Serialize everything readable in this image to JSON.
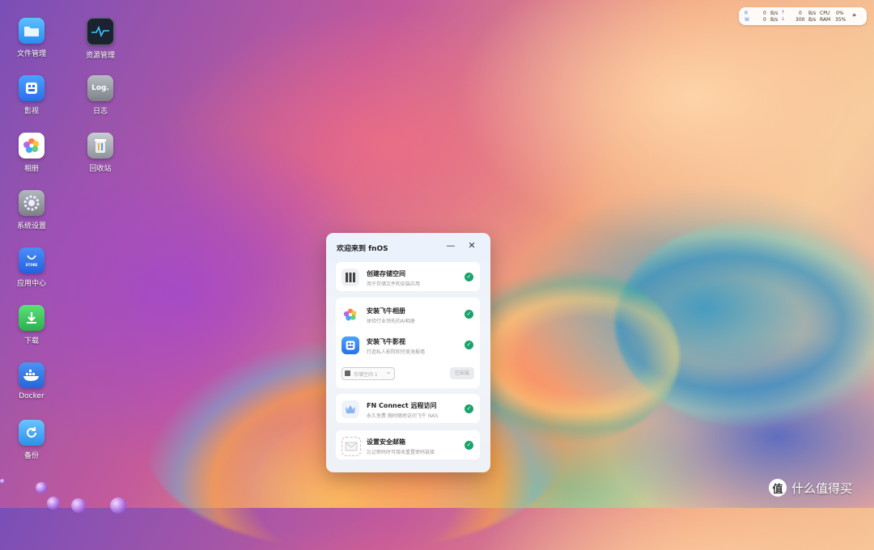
{
  "desktop": {
    "icons": [
      {
        "label": "文件管理",
        "icon": "folder-icon",
        "color": "#2f9bf5"
      },
      {
        "label": "资源管理",
        "icon": "monitor-icon",
        "color": "#1b2230"
      },
      {
        "label": "影视",
        "icon": "film-icon",
        "color": "#2d7ff0"
      },
      {
        "label": "日志",
        "icon": "log-icon",
        "color": "#8b8f95"
      },
      {
        "label": "相册",
        "icon": "photos-icon",
        "color": "#ffffff"
      },
      {
        "label": "回收站",
        "icon": "trash-icon",
        "color": "#9aa0a8"
      },
      {
        "label": "系统设置",
        "icon": "gear-icon",
        "color": "#8a8f96"
      },
      {
        "label": "应用中心",
        "icon": "store-icon",
        "color": "#2f74ee"
      },
      {
        "label": "下载",
        "icon": "download-icon",
        "color": "#35c25a"
      },
      {
        "label": "Docker",
        "icon": "docker-icon",
        "color": "#2a73e0"
      },
      {
        "label": "备份",
        "icon": "backup-icon",
        "color": "#3aa0ef"
      }
    ],
    "log_badge": "Log.",
    "store_badge": "STORE"
  },
  "status": {
    "r_label": "R",
    "w_label": "W",
    "r_value": "0",
    "w_value": "0",
    "r_unit": "B/s",
    "w_unit": "B/s",
    "up_value": "0",
    "down_value": "300",
    "up_unit": "B/s",
    "down_unit": "B/s",
    "cpu_label": "CPU",
    "ram_label": "RAM",
    "cpu_value": "0%",
    "ram_value": "35%"
  },
  "window": {
    "title": "欢迎来到 fnOS",
    "items": [
      {
        "title": "创建存储空间",
        "desc": "用于存储文件和安装应用",
        "icon": "storage-icon",
        "done": true
      },
      {
        "title": "安装飞牛相册",
        "desc": "体验行业领先的AI相册",
        "icon": "photos-icon",
        "done": true
      },
      {
        "title": "安装飞牛影视",
        "desc": "打造私人影院和完美海报墙",
        "icon": "film-icon",
        "done": true
      },
      {
        "title": "FN Connect 远程访问",
        "desc": "永久免费 随时随地访问飞牛 NAS",
        "icon": "crown-icon",
        "done": true
      },
      {
        "title": "设置安全邮箱",
        "desc": "忘记密码时可接收重置密码链接",
        "icon": "mail-icon",
        "done": true
      }
    ],
    "storage_select_placeholder": "存储空间 1",
    "installed_label": "已安装"
  },
  "watermark": {
    "text": "什么值得买",
    "logo_char": "值"
  }
}
